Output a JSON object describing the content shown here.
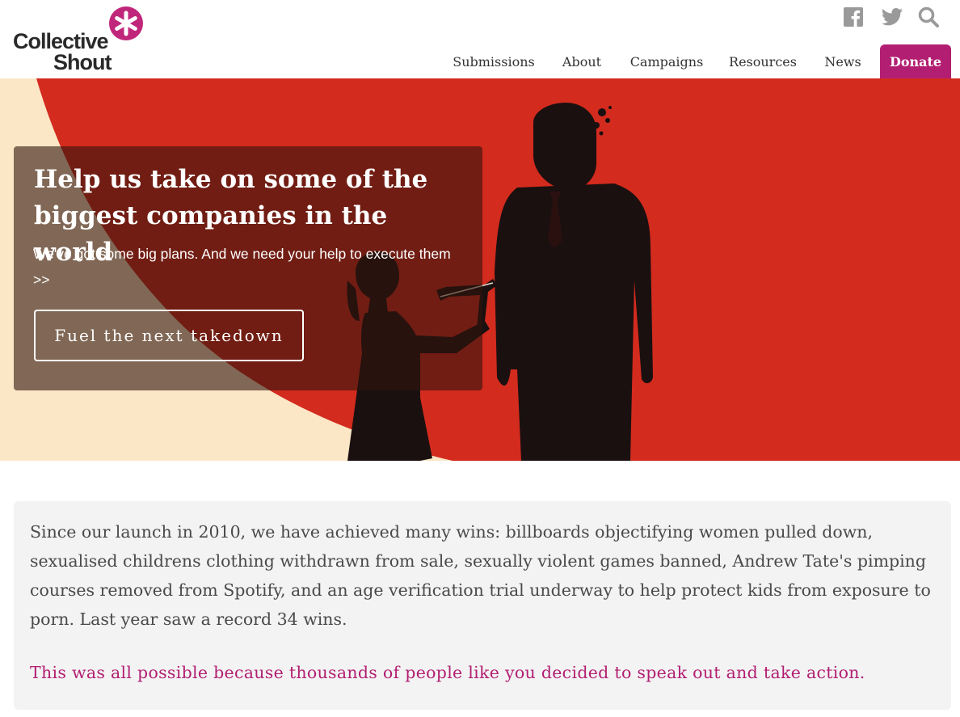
{
  "brand": {
    "name_line1": "Collective",
    "name_line2": "Shout",
    "accent_color": "#b21f72"
  },
  "header": {
    "social_icons": [
      "facebook-icon",
      "twitter-icon",
      "search-icon"
    ],
    "nav": [
      {
        "label": "Submissions"
      },
      {
        "label": "About"
      },
      {
        "label": "Campaigns"
      },
      {
        "label": "Resources"
      },
      {
        "label": "News"
      }
    ],
    "donate_label": "Donate"
  },
  "hero": {
    "title": "Help us take on some of the biggest companies in the world",
    "subtitle": "We've got some big plans. And we need your help to execute them >>",
    "cta_label": "Fuel the next takedown",
    "colors": {
      "red": "#d32b1e",
      "cream": "#fbe6c6",
      "silhouette": "#1a1010"
    }
  },
  "intro": {
    "text": "Since our launch in 2010, we have achieved many wins: billboards objectifying women pulled down, sexualised childrens clothing withdrawn from sale, sexually violent games banned, Andrew Tate's pimping courses removed from Spotify, and an age verification trial underway to help protect kids from exposure to porn. Last year saw a record 34 wins.",
    "highlight": "This was all possible because thousands of people like you decided to speak out and take action."
  }
}
